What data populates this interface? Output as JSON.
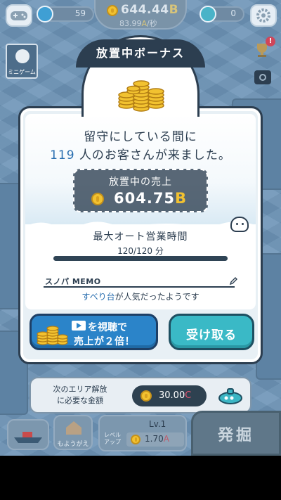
{
  "hud": {
    "gems_count": "59",
    "money_value": "644.44",
    "money_unit": "B",
    "money_rate": "83.99",
    "money_rate_unit": "A",
    "money_rate_suffix": "/秒",
    "diamonds_count": "0",
    "minigame_label": "ミニゲーム"
  },
  "modal": {
    "title": "放置中ボーナス",
    "message_line1": "留守にしている間に",
    "visitors_count": "119",
    "message_line2_suffix": " 人のお客さんが来ました。",
    "sales_label": "放置中の売上",
    "sales_value": "604.75",
    "sales_unit": "B",
    "max_time_label": "最大オート営業時間",
    "max_time_value": "120/120 分",
    "max_time_progress_percent": 100,
    "memo_title": "スノパ MEMO",
    "memo_accent": "すべり台",
    "memo_text_suffix": "が人気だったようです",
    "ad_button_line1": "を視聴で",
    "ad_button_line2": "売上が２倍！",
    "receive_button": "受け取る"
  },
  "next_area": {
    "line1": "次のエリア解放",
    "line2": "に必要な金額",
    "price_value": "30.00",
    "price_unit": "C"
  },
  "bottom": {
    "remodel_label": "もようがえ",
    "level_label": "Lv.1",
    "levelup_label": "レベル\nアップ",
    "levelup_cost": "1.70",
    "levelup_cost_unit": "A",
    "dig_label": "発掘"
  },
  "colors": {
    "dark_navy": "#2c3e50",
    "accent_blue": "#2a6fb0",
    "coin_gold": "#f2c230",
    "teal_button": "#3ab9c6",
    "blue_button": "#2b84c9"
  }
}
